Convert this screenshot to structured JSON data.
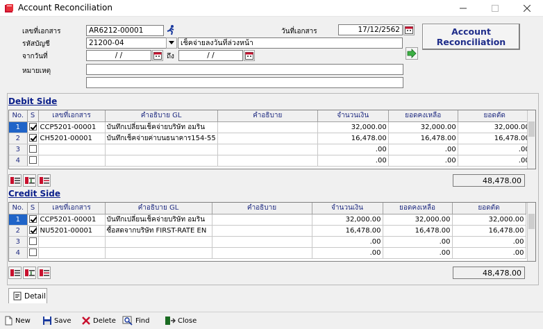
{
  "window": {
    "title": "Account Reconciliation"
  },
  "form": {
    "doc_no_label": "เลขที่เอกสาร",
    "doc_no": "AR6212-00001",
    "doc_date_label": "วันที่เอกสาร",
    "doc_date": "17/12/2562",
    "account_label": "รหัสบัญชี",
    "account_code": "21200-04",
    "account_name": "เช็คจ่ายลงวันที่ล่วงหน้า",
    "from_date_label": "จากวันที่",
    "from_date": "/  /",
    "to_label": "ถึง",
    "to_date": "/  /",
    "note_label": "หมายเหตุ",
    "note1": "",
    "note2": ""
  },
  "buttons": {
    "account_reconciliation": "Account Reconciliation"
  },
  "debit": {
    "title": "Debit Side",
    "columns": [
      "No.",
      "S",
      "เลขที่เอกสาร",
      "คำอธิบาย GL",
      "คำอธิบาย",
      "จำนวนเงิน",
      "ยอดคงเหลือ",
      "ยอดตัด"
    ],
    "rows": [
      {
        "no": "1",
        "checked": true,
        "doc": "CCP5201-00001",
        "gl": "บันทึกเปลี่ยนเช็คจ่ายบริษัท อมริน",
        "desc": "",
        "amount": "32,000.00",
        "balance": "32,000.00",
        "cut": "32,000.00"
      },
      {
        "no": "2",
        "checked": true,
        "doc": "CH5201-00001",
        "gl": "บันทึกเช็คจ่ายค่าบนธนาคาร154-55",
        "desc": "",
        "amount": "16,478.00",
        "balance": "16,478.00",
        "cut": "16,478.00"
      },
      {
        "no": "3",
        "checked": false,
        "doc": "",
        "gl": "",
        "desc": "",
        "amount": ".00",
        "balance": ".00",
        "cut": ".00"
      },
      {
        "no": "4",
        "checked": false,
        "doc": "",
        "gl": "",
        "desc": "",
        "amount": ".00",
        "balance": ".00",
        "cut": ".00"
      }
    ],
    "total": "48,478.00"
  },
  "credit": {
    "title": "Credit Side",
    "columns": [
      "No.",
      "S",
      "เลขที่เอกสาร",
      "คำอธิบาย GL",
      "คำอธิบาย",
      "จำนวนเงิน",
      "ยอดคงเหลือ",
      "ยอดตัด"
    ],
    "rows": [
      {
        "no": "1",
        "checked": true,
        "doc": "CCP5201-00001",
        "gl": "บันทึกเปลี่ยนเช็คจ่ายบริษัท อมริน",
        "desc": "",
        "amount": "32,000.00",
        "balance": "32,000.00",
        "cut": "32,000.00"
      },
      {
        "no": "2",
        "checked": true,
        "doc": "NU5201-00001",
        "gl": "ซื้อสดจากบริษัท FIRST-RATE EN",
        "desc": "",
        "amount": "16,478.00",
        "balance": "16,478.00",
        "cut": "16,478.00"
      },
      {
        "no": "3",
        "checked": false,
        "doc": "",
        "gl": "",
        "desc": "",
        "amount": ".00",
        "balance": ".00",
        "cut": ".00"
      },
      {
        "no": "4",
        "checked": false,
        "doc": "",
        "gl": "",
        "desc": "",
        "amount": ".00",
        "balance": ".00",
        "cut": ".00"
      }
    ],
    "total": "48,478.00"
  },
  "tabs": {
    "detail": "Detail"
  },
  "toolbar": {
    "new": "New",
    "save": "Save",
    "delete": "Delete",
    "find": "Find",
    "close": "Close"
  }
}
